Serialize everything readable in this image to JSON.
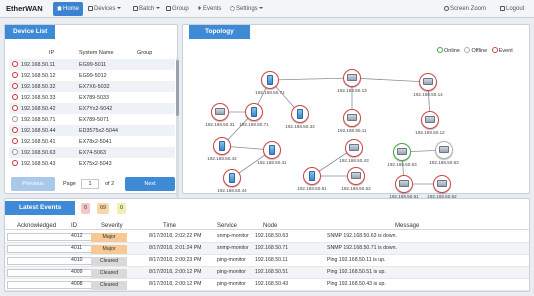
{
  "nav": {
    "brand": "EtherWAN",
    "home": "Home",
    "devices": "Devices",
    "batch": "Batch",
    "group": "Group",
    "events": "Events",
    "settings": "Settings",
    "screen_zoom": "Screen Zoom",
    "logout": "Logout"
  },
  "device_list": {
    "title": "Device List",
    "columns": [
      "IP",
      "System Name",
      "Group"
    ],
    "rows": [
      {
        "ip": "192.168.50.11",
        "name": "EG99-5011",
        "status": "event"
      },
      {
        "ip": "192.168.50.12",
        "name": "EG99-5012",
        "status": "event"
      },
      {
        "ip": "192.168.50.32",
        "name": "EX7X6-5032",
        "status": "event"
      },
      {
        "ip": "192.168.50.33",
        "name": "EX789-5033",
        "status": "event"
      },
      {
        "ip": "192.168.50.42",
        "name": "EX7Yx2-5042",
        "status": "event"
      },
      {
        "ip": "192.168.50.71",
        "name": "EX789-5071",
        "status": "offline"
      },
      {
        "ip": "192.168.50.44",
        "name": "ED3575x2-5044",
        "status": "event"
      },
      {
        "ip": "192.168.50.41",
        "name": "EX78x2-5041",
        "status": "event"
      },
      {
        "ip": "192.168.50.63",
        "name": "EX74-5063",
        "status": "offline"
      },
      {
        "ip": "192.168.50.43",
        "name": "EX75x2-5043",
        "status": "event"
      }
    ],
    "pager": {
      "previous": "Previous",
      "page_label": "Page",
      "page_value": "1",
      "of_label": "of 2",
      "next": "Next"
    }
  },
  "topology": {
    "title": "Topology",
    "legend": {
      "online": "Online",
      "offline": "Offline",
      "event": "Event"
    },
    "colors": {
      "online": "#45a845",
      "offline": "#b0b0b0",
      "event": "#d04545"
    },
    "nodes": [
      {
        "id": "n71a",
        "label": "192.168.50.71",
        "status": "event",
        "kind": "blue"
      },
      {
        "id": "n13",
        "label": "192.168.50.13",
        "status": "event",
        "kind": "switch"
      },
      {
        "id": "n14",
        "label": "192.168.50.14",
        "status": "event",
        "kind": "switch"
      },
      {
        "id": "n31",
        "label": "192.168.50.31",
        "status": "event",
        "kind": "switch"
      },
      {
        "id": "n71b",
        "label": "192.168.50.71",
        "status": "event",
        "kind": "blue"
      },
      {
        "id": "n33",
        "label": "192.168.50.33",
        "status": "event",
        "kind": "blue"
      },
      {
        "id": "n11",
        "label": "192.168.50.11",
        "status": "event",
        "kind": "switch"
      },
      {
        "id": "n12",
        "label": "192.168.50.12",
        "status": "event",
        "kind": "switch"
      },
      {
        "id": "n42",
        "label": "192.168.50.42",
        "status": "event",
        "kind": "blue"
      },
      {
        "id": "n41",
        "label": "192.168.50.41",
        "status": "event",
        "kind": "blue"
      },
      {
        "id": "n43",
        "label": "192.168.50.43",
        "status": "event",
        "kind": "switch"
      },
      {
        "id": "n63a",
        "label": "192.168.50.63",
        "status": "online",
        "kind": "switch"
      },
      {
        "id": "n63b",
        "label": "192.168.50.63",
        "status": "offline",
        "kind": "switch"
      },
      {
        "id": "n51",
        "label": "192.168.50.51",
        "status": "event",
        "kind": "blue"
      },
      {
        "id": "n52",
        "label": "192.168.50.52",
        "status": "event",
        "kind": "switch"
      },
      {
        "id": "n44",
        "label": "192.168.50.44",
        "status": "event",
        "kind": "blue"
      },
      {
        "id": "n61",
        "label": "192.168.50.61",
        "status": "event",
        "kind": "switch"
      },
      {
        "id": "n62",
        "label": "192.168.50.62",
        "status": "event",
        "kind": "switch"
      }
    ]
  },
  "events": {
    "title": "Latest Events",
    "badges": [
      {
        "value": "0",
        "color": "#f6c6c6"
      },
      {
        "value": "69",
        "color": "#f7d9a8"
      },
      {
        "value": "0",
        "color": "#f3efb0"
      }
    ],
    "columns": [
      "Acknowledged",
      "ID",
      "Severity",
      "Time",
      "Service",
      "Node",
      "Message"
    ],
    "rows": [
      {
        "id": "4012",
        "severity": "Major",
        "time": "8/17/2018, 2:02:22 PM",
        "service": "snmp-monitor",
        "node": "192.168.50.63",
        "message": "SNMP 192.168.50.63 is down."
      },
      {
        "id": "4011",
        "severity": "Major",
        "time": "8/17/2018, 2:01:24 PM",
        "service": "snmp-monitor",
        "node": "192.168.50.71",
        "message": "SNMP 192.168.50.71 is down."
      },
      {
        "id": "4010",
        "severity": "Cleared",
        "time": "8/17/2018, 2:00:23 PM",
        "service": "ping-monitor",
        "node": "192.168.50.11",
        "message": "Ping 192.168.50.11 is up."
      },
      {
        "id": "4009",
        "severity": "Cleared",
        "time": "8/17/2018, 2:00:12 PM",
        "service": "ping-monitor",
        "node": "192.168.50.51",
        "message": "Ping 192.168.50.51 is up."
      },
      {
        "id": "4008",
        "severity": "Cleared",
        "time": "8/17/2018, 2:00:12 PM",
        "service": "ping-monitor",
        "node": "192.168.50.43",
        "message": "Ping 192.168.50.43 is up."
      }
    ]
  }
}
